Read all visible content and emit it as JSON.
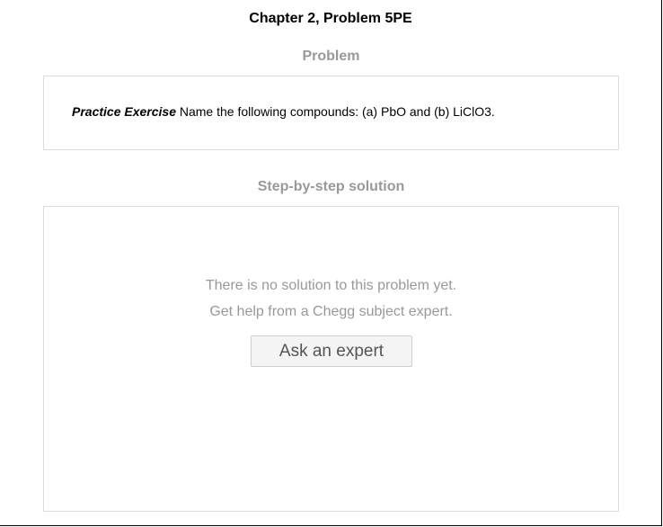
{
  "header": {
    "chapter_title": "Chapter 2, Problem 5PE"
  },
  "problem": {
    "heading": "Problem",
    "lead": "Practice Exercise",
    "text": " Name the following compounds: (a) PbO and (b) LiClO3."
  },
  "solution": {
    "heading": "Step-by-step solution",
    "message_line1": "There is no solution to this problem yet.",
    "message_line2": "Get help from a Chegg subject expert.",
    "ask_button_label": "Ask an expert"
  },
  "colors": {
    "heading_gray": "#999999",
    "panel_border": "#dcdcdc",
    "button_bg": "#f4f4f4"
  }
}
